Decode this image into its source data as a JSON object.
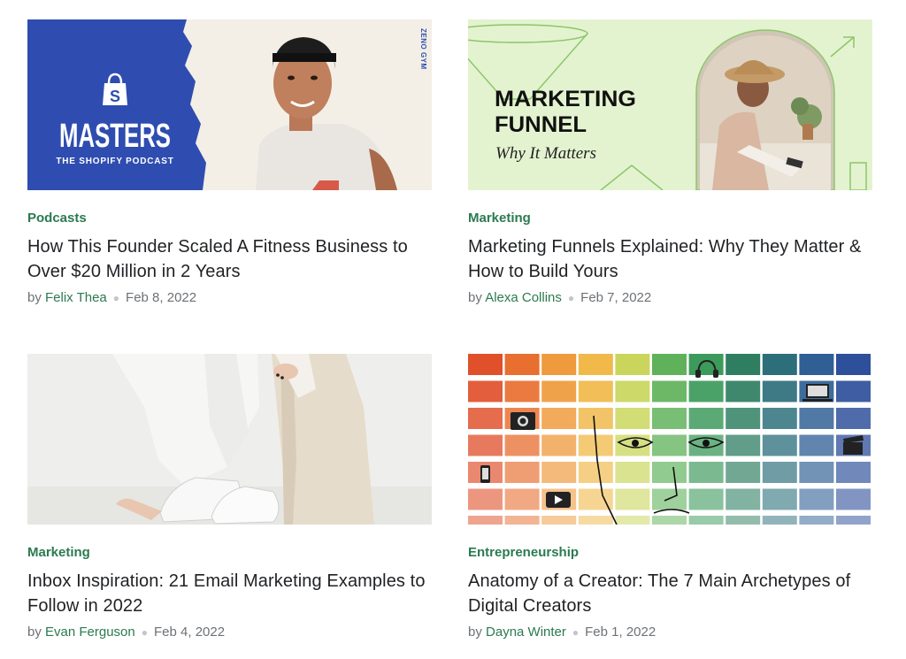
{
  "articles": [
    {
      "category": "Podcasts",
      "title": "How This Founder Scaled A Fitness Business to Over $20 Million in 2 Years",
      "by": "by",
      "author": "Felix Thea",
      "date": "Feb 8, 2022",
      "image": {
        "headline": "MASTERS",
        "subline": "THE SHOPIFY PODCAST",
        "side_text": "ZENO GYM"
      }
    },
    {
      "category": "Marketing",
      "title": "Marketing Funnels Explained: Why They Matter & How to Build Yours",
      "by": "by",
      "author": "Alexa Collins",
      "date": "Feb 7, 2022",
      "image": {
        "headline_1": "MARKETING",
        "headline_2": "FUNNEL",
        "subline": "Why It Matters"
      }
    },
    {
      "category": "Marketing",
      "title": "Inbox Inspiration: 21 Email Marketing Examples to Follow in 2022",
      "by": "by",
      "author": "Evan Ferguson",
      "date": "Feb 4, 2022"
    },
    {
      "category": "Entrepreneurship",
      "title": "Anatomy of a Creator: The 7 Main Archetypes of Digital Creators",
      "by": "by",
      "author": "Dayna Winter",
      "date": "Feb 1, 2022"
    }
  ],
  "colors": {
    "accent": "#2b7a50",
    "masters_blue": "#2f4db0",
    "funnel_green": "#e3f3cf"
  }
}
